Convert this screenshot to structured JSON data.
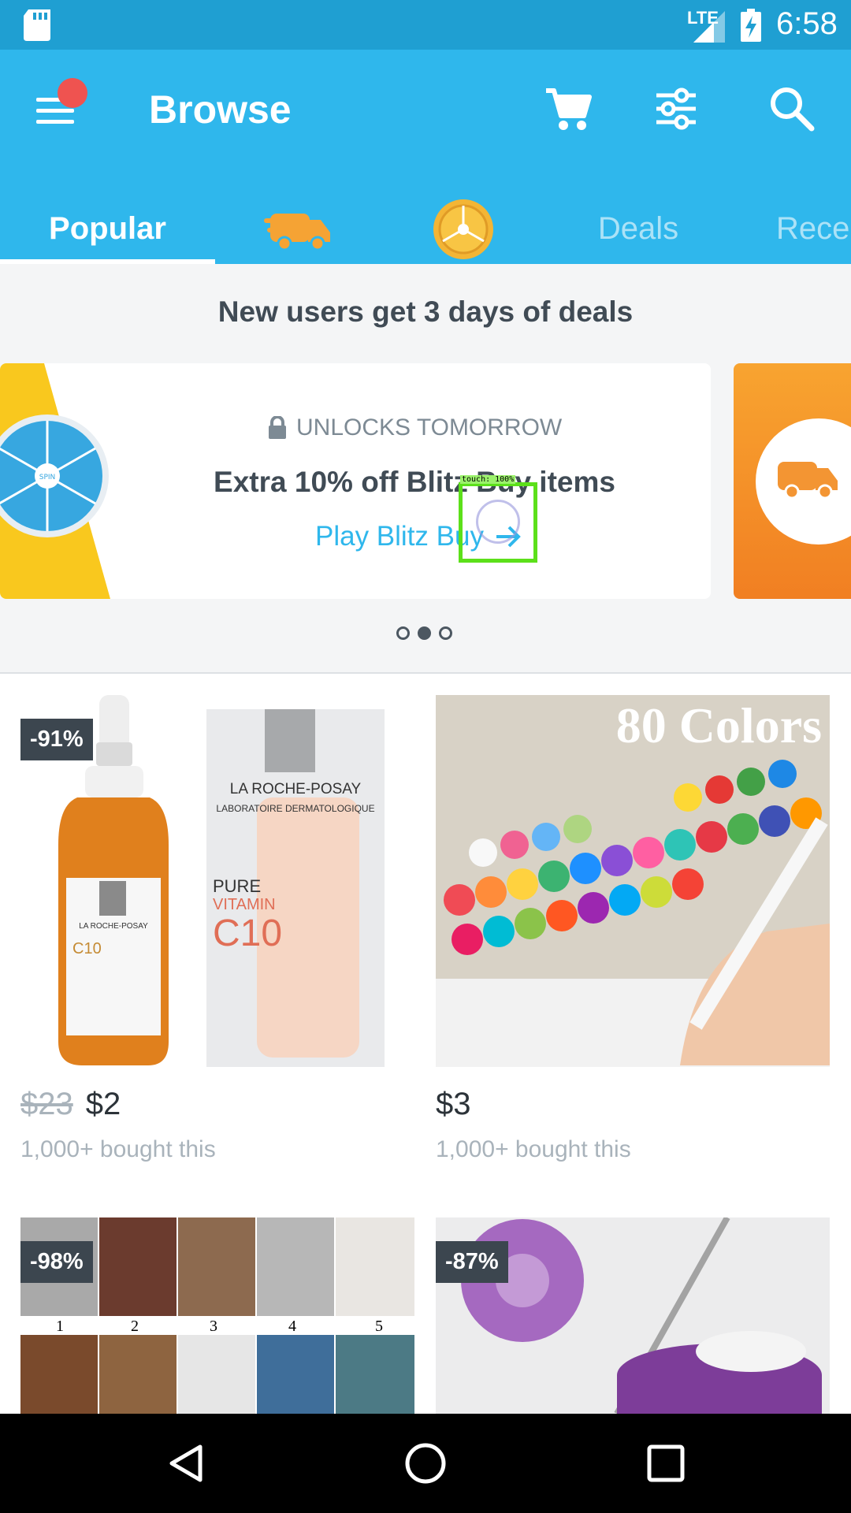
{
  "status_bar": {
    "network": "LTE",
    "time": "6:58"
  },
  "app_bar": {
    "title": "Browse"
  },
  "tabs": [
    {
      "label": "Popular"
    },
    {
      "label": ""
    },
    {
      "label": ""
    },
    {
      "label": "Deals"
    },
    {
      "label": "Rece"
    }
  ],
  "promo": {
    "heading": "New users get 3 days of deals",
    "lock_text": "UNLOCKS TOMORROW",
    "card_title": "Extra 10% off Blitz Buy items",
    "card_link": "Play Blitz Buy",
    "carousel_active_index": 1
  },
  "touch_overlay": {
    "label": "touch: 100%"
  },
  "products": [
    {
      "badge": "-91%",
      "old_price": "$23",
      "price": "$2",
      "bought": "1,000+ bought this",
      "image_text": {
        "brand": "LA ROCHE-POSAY",
        "sub": "LABORATOIRE DERMATOLOGIQUE",
        "line1": "PURE",
        "line2": "VITAMIN",
        "line3": "C10"
      }
    },
    {
      "badge": "",
      "old_price": "",
      "price": "$3",
      "bought": "1,000+ bought this",
      "image_text": {
        "headline": "80 Colors"
      }
    },
    {
      "badge": "-98%",
      "old_price": "",
      "price": "",
      "bought": "",
      "image_text": {
        "n1": "1",
        "n2": "2",
        "n3": "3",
        "n4": "4",
        "n5": "5"
      }
    },
    {
      "badge": "-87%",
      "old_price": "",
      "price": "",
      "bought": "",
      "image_text": {}
    }
  ],
  "colors": {
    "appbar": "#2fb7ec",
    "statusbar": "#1f9fd2",
    "accent": "#2fb7ec",
    "text_dark": "#404b55"
  }
}
